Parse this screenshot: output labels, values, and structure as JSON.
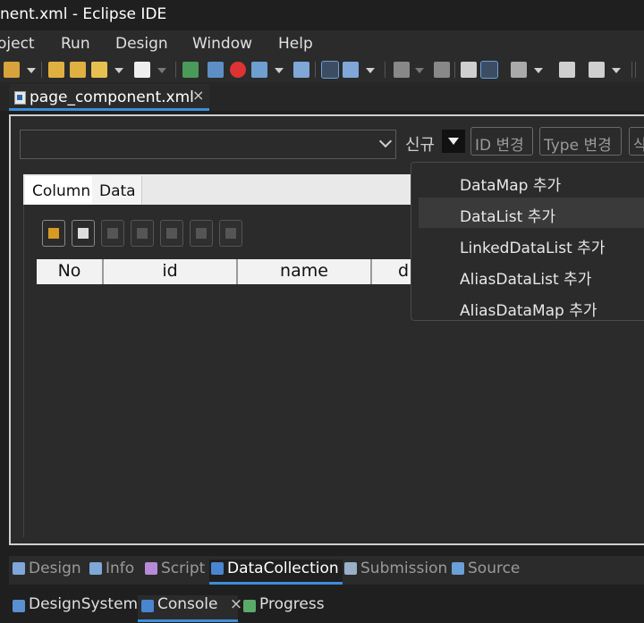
{
  "window": {
    "title": "nent.xml - Eclipse IDE"
  },
  "menu": {
    "items": [
      "oject",
      "Run",
      "Design",
      "Window",
      "Help"
    ]
  },
  "editor": {
    "tab_label": "page_component.xml",
    "tab_close": "×"
  },
  "form": {
    "new_label": "신규",
    "buttons": [
      "ID 변경",
      "Type 변경",
      "삭"
    ]
  },
  "inner_tabs": [
    "Column",
    "Data"
  ],
  "table": {
    "headers": [
      "No",
      "id",
      "name",
      "d"
    ]
  },
  "popup": {
    "items": [
      "DataMap 추가",
      "DataList 추가",
      "LinkedDataList 추가",
      "AliasDataList 추가",
      "AliasDataMap 추가"
    ],
    "highlighted_index": 1
  },
  "bottom_tabs": [
    "Design",
    "Info",
    "Script",
    "DataCollection",
    "Submission",
    "Source"
  ],
  "bottom_active": "DataCollection",
  "bottom_tabs2": [
    {
      "label": "DesignSystem"
    },
    {
      "label": "Console",
      "close": "×"
    },
    {
      "label": "Progress"
    }
  ],
  "colors": {
    "accent": "#3b8fd8",
    "background": "#1f1f1f",
    "panel": "#2b2b2b"
  }
}
